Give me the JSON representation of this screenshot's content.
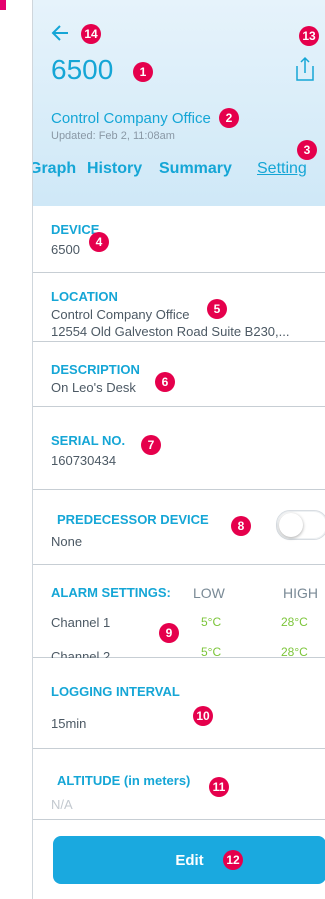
{
  "header": {
    "back_icon": "arrow-left-icon",
    "share_icon": "share-icon",
    "title": "6500",
    "subtitle": "Control Company Office",
    "updated": "Updated: Feb 2, 11:08am",
    "tabs": [
      {
        "label": "Graph"
      },
      {
        "label": "History"
      },
      {
        "label": "Summary"
      },
      {
        "label": "Setting"
      }
    ],
    "active_tab": "Setting"
  },
  "sections": {
    "device": {
      "label": "DEVICE",
      "value": "6500"
    },
    "location": {
      "label": "LOCATION",
      "line1": "Control Company Office",
      "line2": "12554 Old Galveston Road Suite B230,..."
    },
    "description": {
      "label": "DESCRIPTION",
      "value": "On Leo's Desk"
    },
    "serial": {
      "label": "SERIAL NO.",
      "value": "160730434"
    },
    "predecessor": {
      "label": "PREDECESSOR DEVICE",
      "value": "None",
      "toggle_on": false
    },
    "alarm": {
      "label": "ALARM SETTINGS:",
      "low": "LOW",
      "high": "HIGH",
      "channels": [
        {
          "name": "Channel 1",
          "low": "5°C",
          "high": "28°C"
        },
        {
          "name": "Channel 2",
          "low": "5°C",
          "high": "28°C"
        }
      ]
    },
    "logging": {
      "label": "LOGGING INTERVAL",
      "value": "15min"
    },
    "altitude": {
      "label": "ALTITUDE (in meters)",
      "value": "N/A"
    }
  },
  "edit_label": "Edit",
  "badges": [
    "1",
    "2",
    "3",
    "4",
    "5",
    "6",
    "7",
    "8",
    "9",
    "10",
    "11",
    "12",
    "13",
    "14"
  ],
  "colors": {
    "accent": "#15a6d6",
    "badge": "#e5004c",
    "temp": "#7cc53a",
    "edit_button": "#1aa9df"
  }
}
